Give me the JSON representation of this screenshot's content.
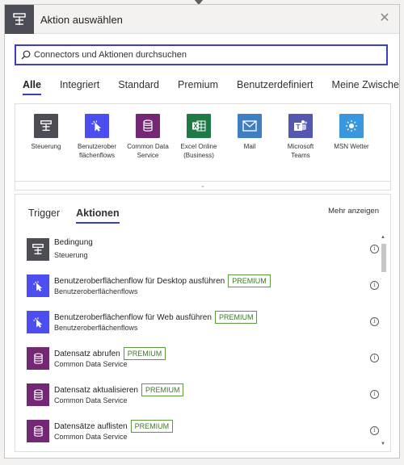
{
  "header": {
    "title": "Aktion auswählen"
  },
  "search": {
    "placeholder": "Connectors und Aktionen durchsuchen"
  },
  "categories": [
    "Alle",
    "Integriert",
    "Standard",
    "Premium",
    "Benutzerdefiniert",
    "Meine Zwischenablage"
  ],
  "connectors": [
    {
      "label": "Steuerung",
      "color": "#4d4d55",
      "icon": "control-icon"
    },
    {
      "label": "Benutzerober flächenflows",
      "color": "#4d4ef0",
      "icon": "ui-flow-icon"
    },
    {
      "label": "Common Data Service",
      "color": "#742774",
      "icon": "database-icon"
    },
    {
      "label": "Excel Online (Business)",
      "color": "#1d7a44",
      "icon": "excel-icon"
    },
    {
      "label": "Mail",
      "color": "#3e7fc1",
      "icon": "mail-icon"
    },
    {
      "label": "Microsoft Teams",
      "color": "#5558af",
      "icon": "teams-icon"
    },
    {
      "label": "MSN Wetter",
      "color": "#3a96dd",
      "icon": "weather-icon"
    }
  ],
  "tabs": {
    "trigger": "Trigger",
    "actions": "Aktionen",
    "more": "Mehr anzeigen"
  },
  "actions": [
    {
      "title": "Bedingung",
      "sub": "Steuerung",
      "premium": false,
      "color": "#4d4d55",
      "icon": "control-icon"
    },
    {
      "title": "Benutzeroberflächenflow für Desktop ausführen",
      "sub": "Benutzeroberflächenflows",
      "premium": true,
      "color": "#4d4ef0",
      "icon": "ui-flow-icon"
    },
    {
      "title": "Benutzeroberflächenflow für Web ausführen",
      "sub": "Benutzeroberflächenflows",
      "premium": true,
      "color": "#4d4ef0",
      "icon": "ui-flow-icon"
    },
    {
      "title": "Datensatz abrufen",
      "sub": "Common Data Service",
      "premium": true,
      "color": "#742774",
      "icon": "database-icon"
    },
    {
      "title": "Datensatz aktualisieren",
      "sub": "Common Data Service",
      "premium": true,
      "color": "#742774",
      "icon": "database-icon"
    },
    {
      "title": "Datensätze auflisten",
      "sub": "Common Data Service",
      "premium": true,
      "color": "#742774",
      "icon": "database-icon"
    }
  ],
  "premium_label": "PREMIUM"
}
